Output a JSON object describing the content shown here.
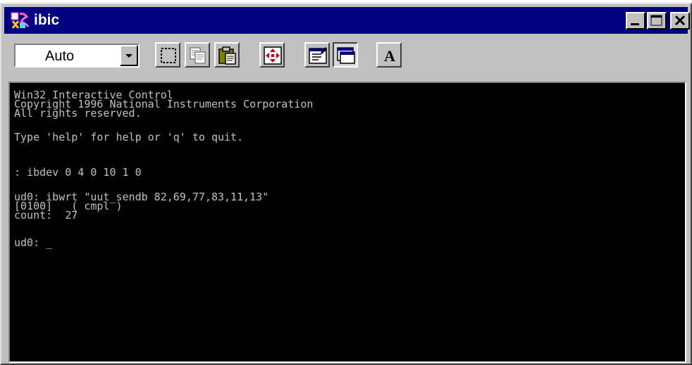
{
  "window": {
    "title": "ibic"
  },
  "toolbar": {
    "mode_select": {
      "value": "Auto"
    },
    "buttons": [
      {
        "icon": "select-icon"
      },
      {
        "icon": "copy-icon"
      },
      {
        "icon": "paste-icon"
      },
      {
        "icon": "move-icon"
      },
      {
        "icon": "properties-icon"
      },
      {
        "icon": "window-icon",
        "pressed": true
      },
      {
        "icon": "font-icon",
        "glyph": "A"
      }
    ]
  },
  "console": {
    "lines": [
      "Win32 Interactive Control",
      "Copyright 1996 National Instruments Corporation",
      "All rights reserved.",
      "Type 'help' for help or 'q' to quit.",
      ": ibdev 0 4 0 10 1 0",
      "ud0: ibwrt \"uut_sendb 82,69,77,83,11,13\"",
      "[0100]   ( cmpl )",
      "count:  27",
      "ud0: _"
    ]
  },
  "colors": {
    "titlebar": "#000080",
    "chrome": "#c0c0c0",
    "console_bg": "#000000",
    "console_text": "#c0c0c0"
  }
}
